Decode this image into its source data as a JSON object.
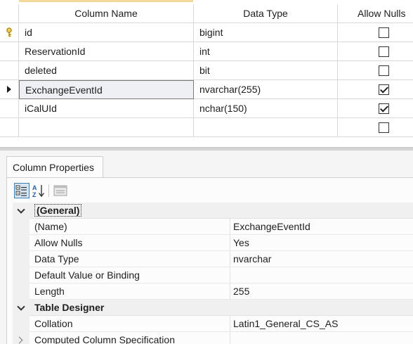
{
  "columns_grid": {
    "headers": {
      "name": "Column Name",
      "type": "Data Type",
      "nulls": "Allow Nulls"
    },
    "rows": [
      {
        "name": "id",
        "type": "bigint",
        "allow_nulls": false,
        "primary_key": true,
        "current": false
      },
      {
        "name": "ReservationId",
        "type": "int",
        "allow_nulls": false,
        "primary_key": false,
        "current": false
      },
      {
        "name": "deleted",
        "type": "bit",
        "allow_nulls": false,
        "primary_key": false,
        "current": false
      },
      {
        "name": "ExchangeEventId",
        "type": "nvarchar(255)",
        "allow_nulls": true,
        "primary_key": false,
        "current": true
      },
      {
        "name": "iCalUId",
        "type": "nchar(150)",
        "allow_nulls": true,
        "primary_key": false,
        "current": false
      },
      {
        "name": "",
        "type": "",
        "allow_nulls": false,
        "primary_key": false,
        "current": false
      }
    ]
  },
  "properties": {
    "tab_label": "Column Properties",
    "toolbar": {
      "categorized": "categorized-icon",
      "alphabetical": "sort-az-icon",
      "property_pages": "property-pages-icon"
    },
    "groups": [
      {
        "label": "(General)",
        "items": [
          {
            "name": "(Name)",
            "value": "ExchangeEventId"
          },
          {
            "name": "Allow Nulls",
            "value": "Yes"
          },
          {
            "name": "Data Type",
            "value": "nvarchar"
          },
          {
            "name": "Default Value or Binding",
            "value": ""
          },
          {
            "name": "Length",
            "value": "255"
          }
        ]
      },
      {
        "label": "Table Designer",
        "items": [
          {
            "name": "Collation",
            "value": "Latin1_General_CS_AS"
          },
          {
            "name": "Computed Column Specification",
            "value": ""
          }
        ]
      }
    ]
  },
  "colors": {
    "key": "#e8b400",
    "accent": "#3c7fb1"
  }
}
